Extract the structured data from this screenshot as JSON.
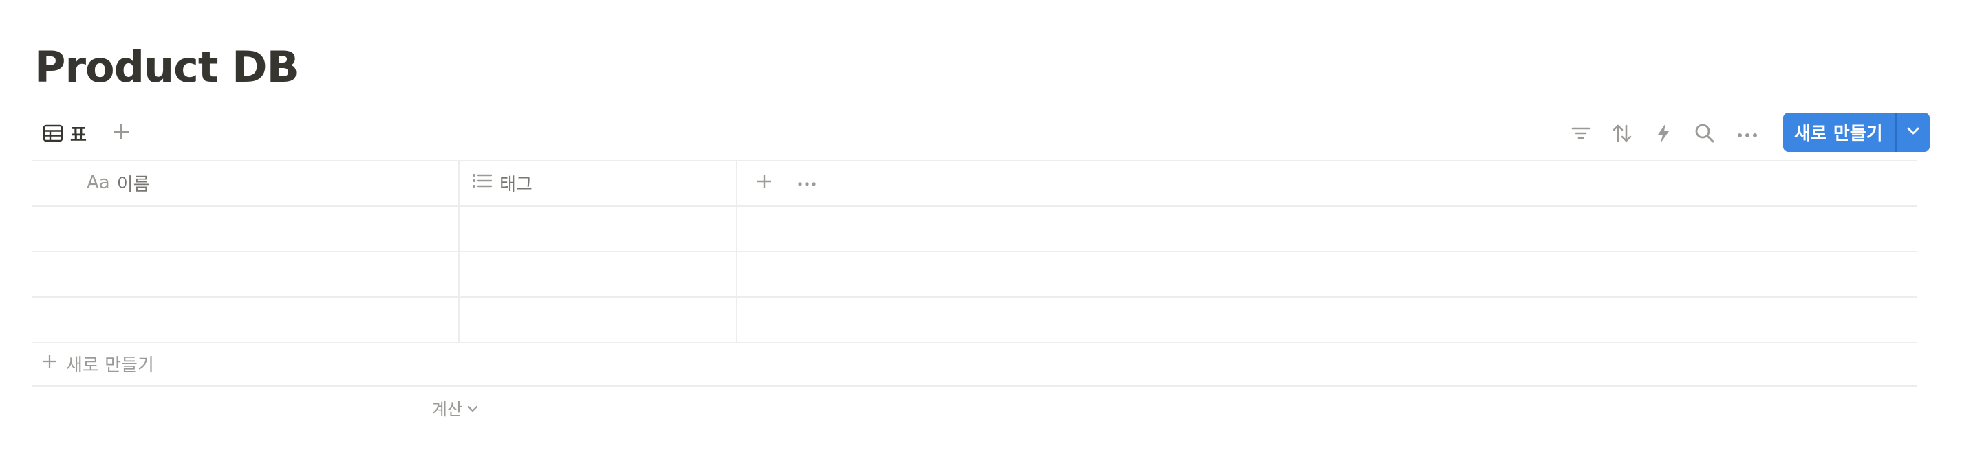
{
  "page": {
    "title": "Product DB"
  },
  "view_bar": {
    "active_view": {
      "label": "표",
      "icon": "table-icon"
    },
    "add_view_icon": "plus-icon",
    "tools": [
      {
        "name": "filter",
        "icon": "filter-icon"
      },
      {
        "name": "sort",
        "icon": "sort-icon"
      },
      {
        "name": "automation",
        "icon": "lightning-icon"
      },
      {
        "name": "search",
        "icon": "search-icon"
      },
      {
        "name": "more",
        "icon": "more-horizontal-icon"
      }
    ],
    "new_button": {
      "label": "새로 만들기",
      "dropdown_icon": "chevron-down-icon",
      "color": "#3b86e3"
    }
  },
  "table": {
    "columns": [
      {
        "label": "이름",
        "type_icon": "Aa"
      },
      {
        "label": "태그",
        "type_icon": "list-icon"
      }
    ],
    "rows": [
      {
        "이름": "",
        "태그": ""
      },
      {
        "이름": "",
        "태그": ""
      },
      {
        "이름": "",
        "태그": ""
      }
    ],
    "add_column_icon": "plus-icon",
    "column_options_icon": "more-horizontal-icon",
    "add_row_label": "새로 만들기",
    "calculate_label": "계산"
  },
  "colors": {
    "text": "#37352f",
    "muted": "#787774",
    "faint": "#9b9a97",
    "border": "#ededec",
    "accent": "#3b86e3"
  }
}
